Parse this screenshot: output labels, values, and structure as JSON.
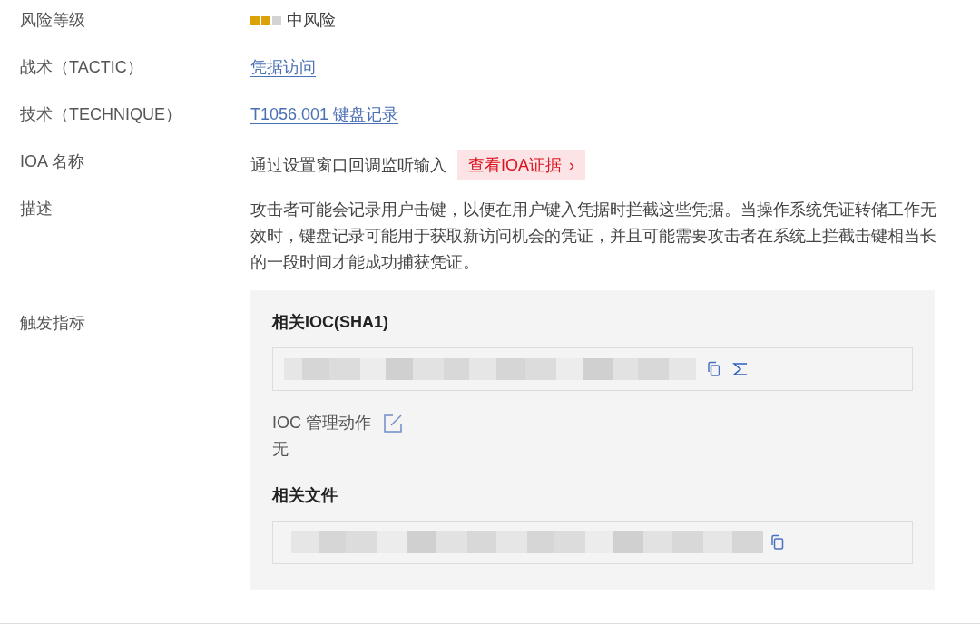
{
  "fields": [
    {
      "kind": "risk",
      "label": "风险等级",
      "level": 0.67,
      "value": "中风险"
    },
    {
      "kind": "link",
      "label": "战术（TACTIC）",
      "value": "凭据访问"
    },
    {
      "kind": "link",
      "label": "技术（TECHNIQUE）",
      "value": "T1056.001 键盘记录"
    },
    {
      "kind": "ioa",
      "label": "IOA 名称",
      "value": "通过设置窗口回调监听输入",
      "button": "查看IOA证据",
      "button_icon": "›"
    },
    {
      "kind": "text",
      "label": "描述",
      "value": "攻击者可能会记录用户击键，以便在用户键入凭据时拦截这些凭据。当操作系统凭证转储工作无效时，键盘记录可能用于获取新访问机会的凭证，并且可能需要攻击者在系统上拦截击键相当长的一段时间才能成功捕获凭证。"
    }
  ],
  "indicators": {
    "label": "触发指标",
    "ioc_title": "相关IOC(SHA1)",
    "action_label": "IOC 管理动作",
    "action_value": "无",
    "files_title": "相关文件"
  }
}
